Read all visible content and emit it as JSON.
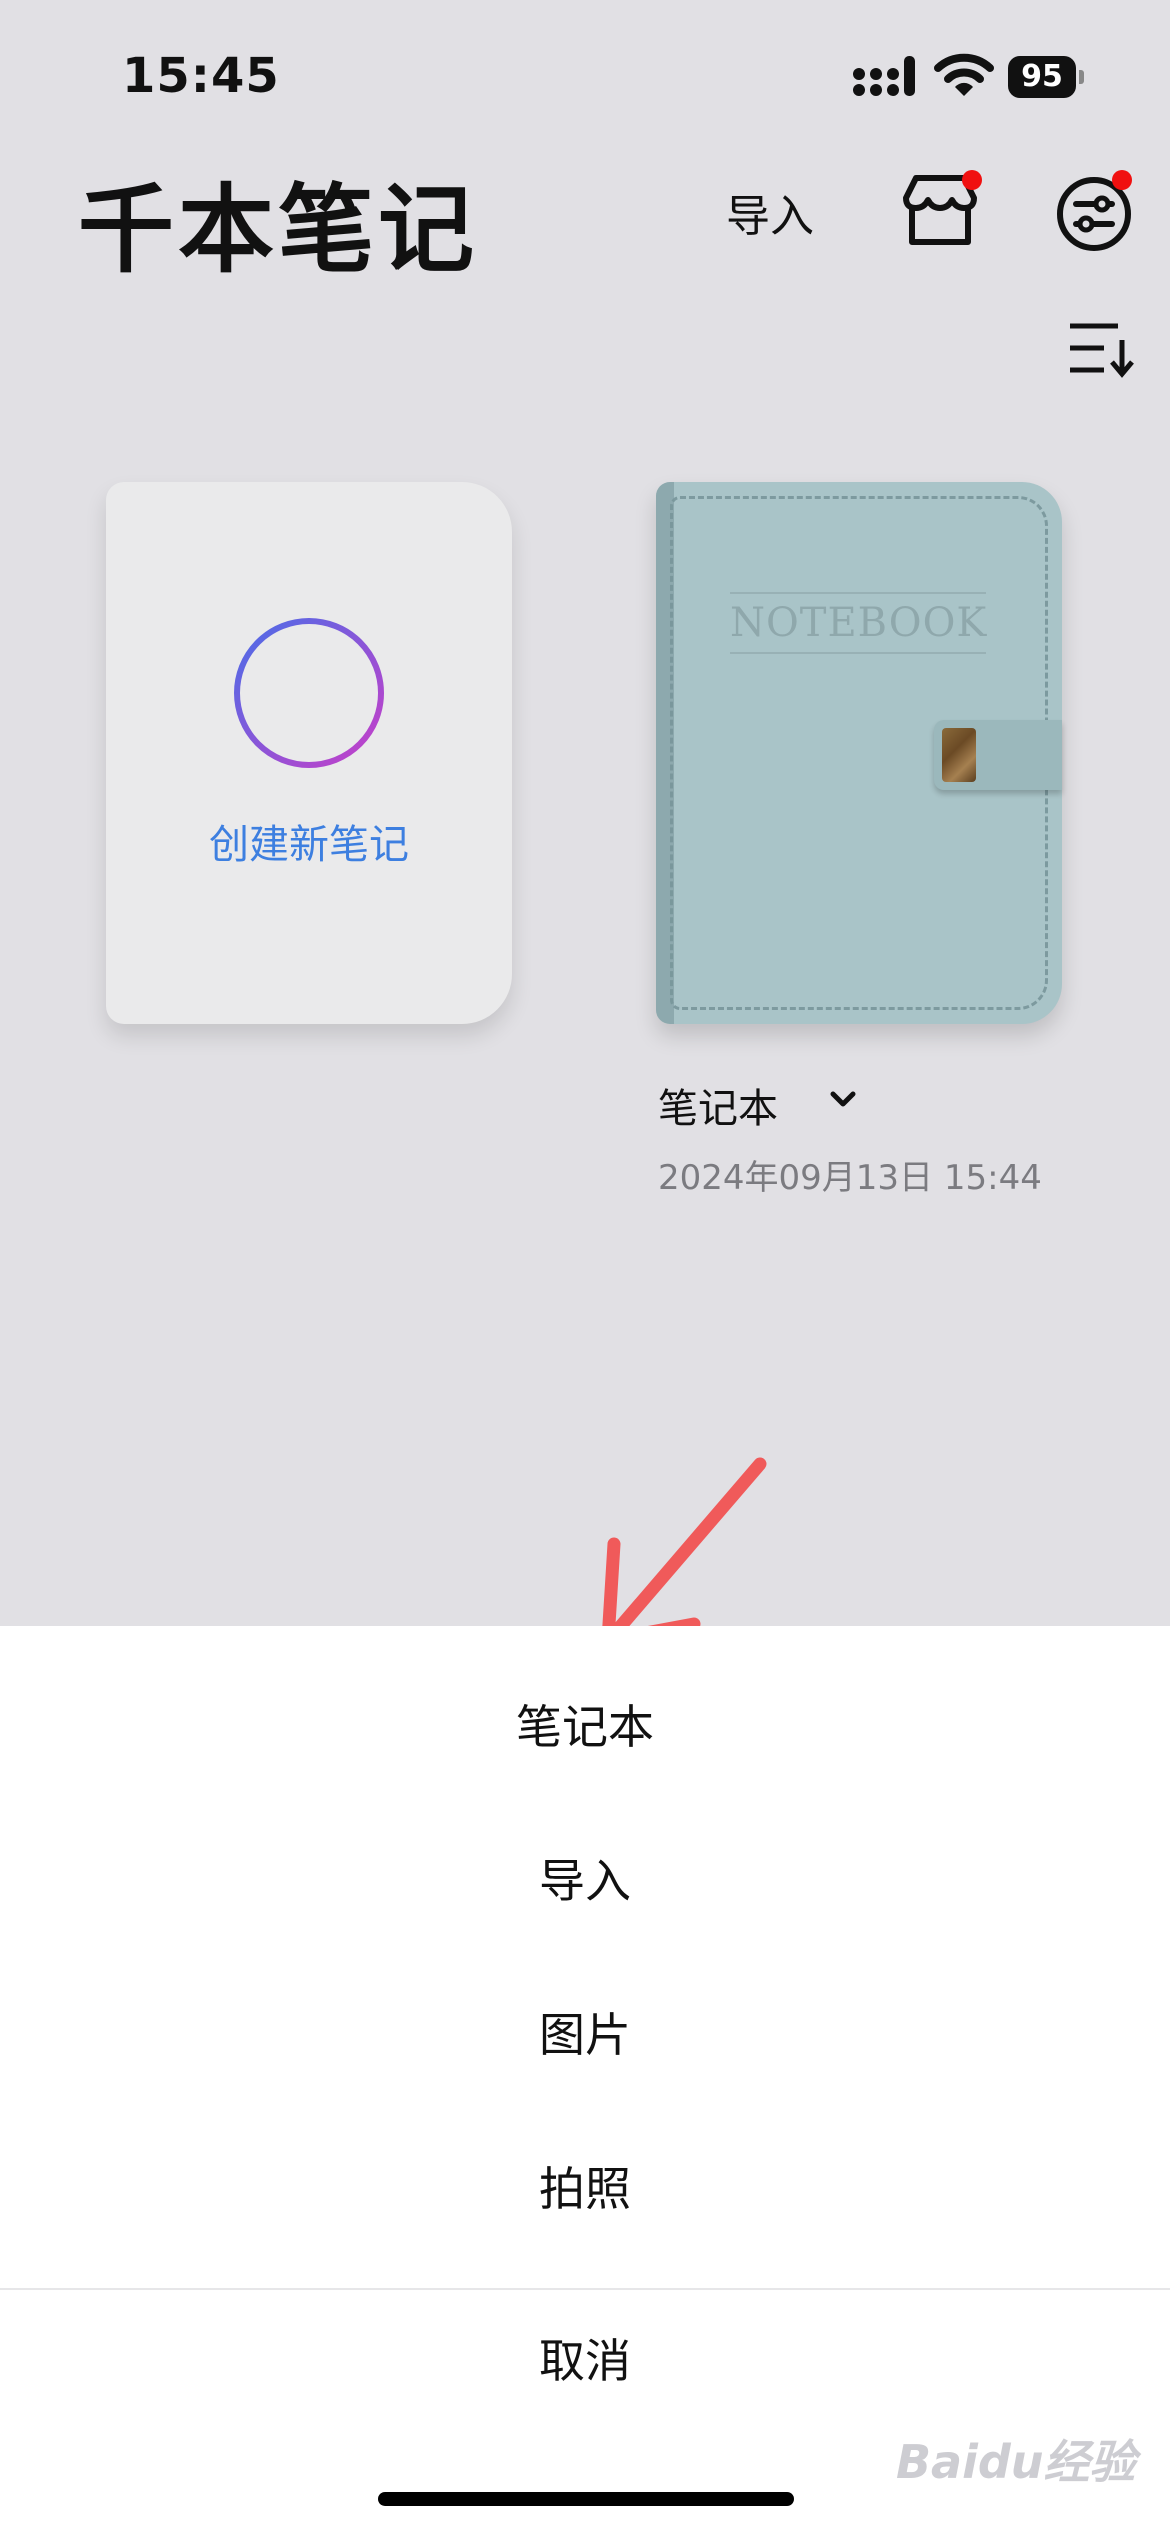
{
  "status_bar": {
    "time": "15:45",
    "battery": "95"
  },
  "header": {
    "title": "千本笔记",
    "import_label": "导入",
    "store_icon": "store-icon",
    "settings_icon": "settings-sliders-icon",
    "sort_icon": "sort-icon"
  },
  "create_card": {
    "label": "创建新笔记",
    "icon": "plus-circle-icon"
  },
  "notebook": {
    "cover_text": "NOTEBOOK",
    "name": "笔记本",
    "date": "2024年09月13日  15:44",
    "cover_color": "#a9c4c8"
  },
  "action_sheet": {
    "items": [
      "笔记本",
      "导入",
      "图片",
      "拍照"
    ],
    "cancel": "取消"
  },
  "watermark": "Baidu经验",
  "colors": {
    "accent_blue": "#3d7fe0",
    "badge_red": "#f01010",
    "annotation_arrow": "#f05a5a"
  }
}
